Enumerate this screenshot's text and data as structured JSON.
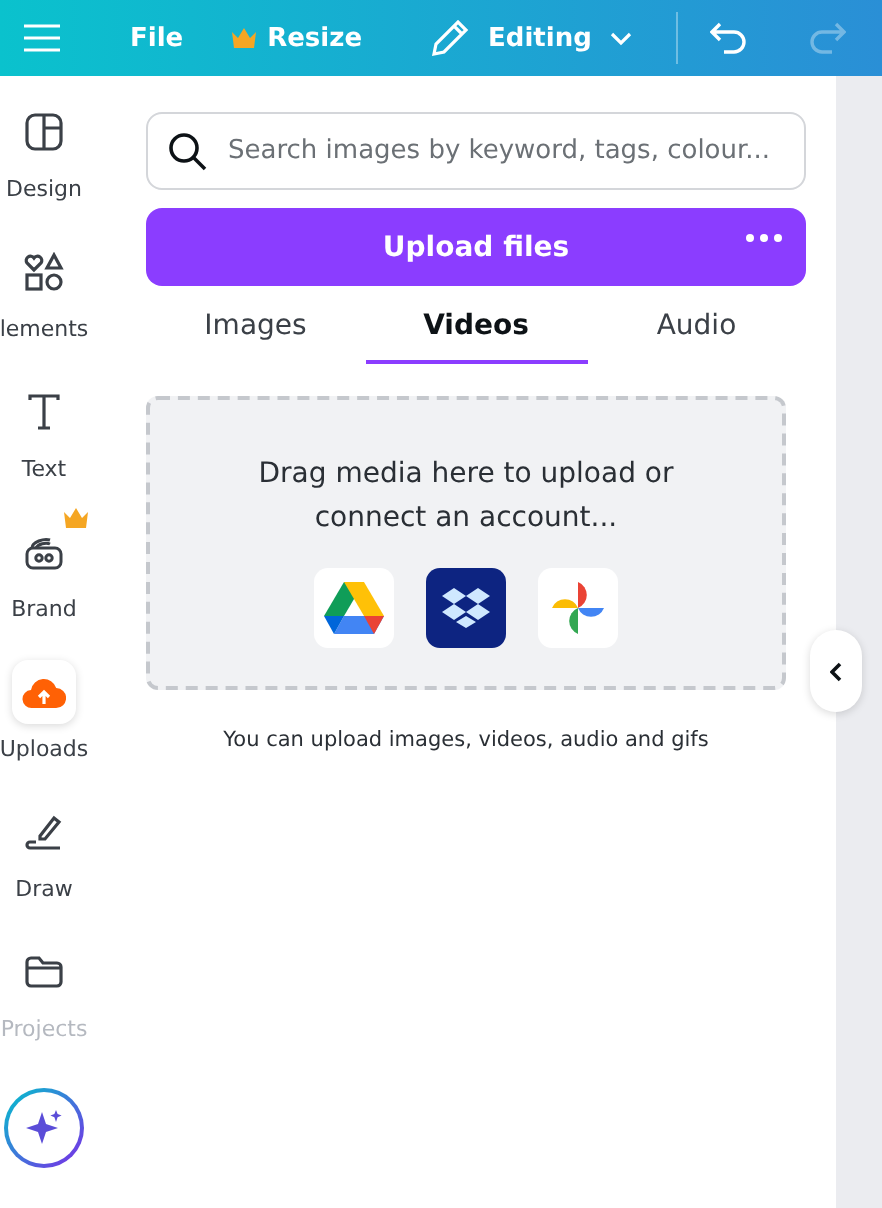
{
  "top_bar": {
    "file": "File",
    "resize": "Resize",
    "mode": "Editing",
    "undo_disabled": false,
    "redo_disabled": true
  },
  "sidebar": {
    "items": [
      {
        "kind": "design",
        "label": "Design",
        "selected": false,
        "disabled": false,
        "premium": false
      },
      {
        "kind": "elements",
        "label": "lements",
        "selected": false,
        "disabled": false,
        "premium": false
      },
      {
        "kind": "text",
        "label": "Text",
        "selected": false,
        "disabled": false,
        "premium": false
      },
      {
        "kind": "brand",
        "label": "Brand",
        "selected": false,
        "disabled": false,
        "premium": true
      },
      {
        "kind": "uploads",
        "label": "Uploads",
        "selected": true,
        "disabled": false,
        "premium": false
      },
      {
        "kind": "draw",
        "label": "Draw",
        "selected": false,
        "disabled": false,
        "premium": false
      },
      {
        "kind": "projects",
        "label": "Projects",
        "selected": false,
        "disabled": true,
        "premium": false
      },
      {
        "kind": "magic",
        "selected": false
      }
    ]
  },
  "panel": {
    "search": {
      "placeholder": "Search images by keyword, tags, colour..."
    },
    "upload_button": "Upload files",
    "tabs": [
      {
        "label": "Images",
        "selected": false
      },
      {
        "label": "Videos",
        "selected": true
      },
      {
        "label": "Audio",
        "selected": false
      }
    ],
    "drop_zone": {
      "text": "Drag media here to upload or connect an account..."
    },
    "caption": "You can upload images, videos, audio and gifs"
  }
}
